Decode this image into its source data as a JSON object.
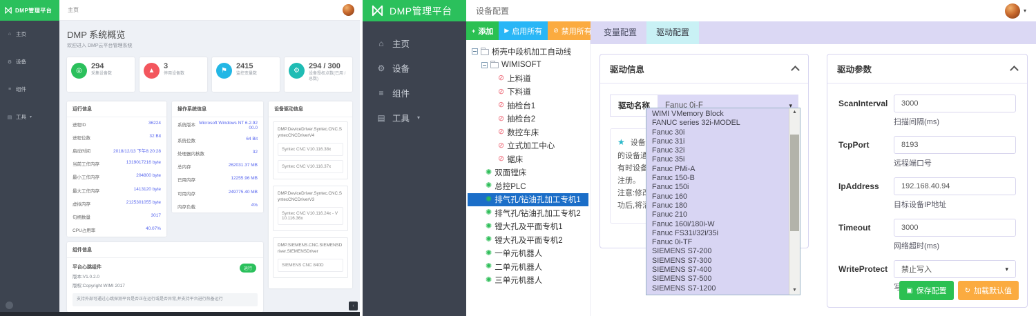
{
  "icons": {
    "home": "⌂",
    "devices": "⚙",
    "components": "≡",
    "tools": "▤",
    "caret_down": "▾",
    "add": "+",
    "enable": "▶",
    "disable": "⊘",
    "scroll_up": "▲",
    "scroll_down": "▼",
    "star": "★",
    "gear_node": "✺",
    "disabled_node": "⊘",
    "save": "▣",
    "reload": "↻",
    "collapse_left": "‹",
    "stat_collect": "◎",
    "stat_stop": "▲",
    "stat_var": "⚑",
    "stat_license": "⚙"
  },
  "sidebar_items": [
    {
      "icon": "home",
      "label": "主页",
      "caret": false
    },
    {
      "icon": "devices",
      "label": "设备",
      "caret": false
    },
    {
      "icon": "components",
      "label": "组件",
      "caret": false
    },
    {
      "icon": "tools",
      "label": "工具",
      "caret": true
    }
  ],
  "left_app": {
    "logo": "DMP管理平台",
    "breadcrumb": "主页",
    "page_title": "DMP 系统概览",
    "page_subtitle": "欢迎进入 DMP云平台管理系统",
    "stats": [
      {
        "value": "294",
        "label": "采集设备数",
        "color": "#2bc05c",
        "icon": "stat_collect"
      },
      {
        "value": "3",
        "label": "停用设备数",
        "color": "#f3565d",
        "icon": "stat_stop"
      },
      {
        "value": "2415",
        "label": "监控变量数",
        "color": "#23b7e5",
        "icon": "stat_var"
      },
      {
        "value": "294 / 300",
        "label": "设备授权点数(已用 / 总数)",
        "color": "#1fbcb4",
        "icon": "stat_license"
      }
    ],
    "run_info": {
      "title": "运行信息",
      "rows": [
        {
          "l": "进程ID",
          "v": "36224"
        },
        {
          "l": "进程位数",
          "v": "32 Bit"
        },
        {
          "l": "启动时间",
          "v": "2018/12/13 下午8:20:28"
        },
        {
          "l": "当前工作内存",
          "v": "1319017216 byte"
        },
        {
          "l": "最小工作内存",
          "v": "204800 byte"
        },
        {
          "l": "最大工作内存",
          "v": "1413120 byte"
        },
        {
          "l": "虚拟内存",
          "v": "2125301055 byte"
        },
        {
          "l": "句柄数量",
          "v": "3017"
        },
        {
          "l": "CPU占用率",
          "v": "40.07%"
        }
      ]
    },
    "os_info": {
      "title": "操作系统信息",
      "rows": [
        {
          "l": "系统版本",
          "v": "Microsoft Windows NT 6.2.9200.0"
        },
        {
          "l": "系统位数",
          "v": "64 Bit"
        },
        {
          "l": "处理器内核数",
          "v": "32"
        },
        {
          "l": "总内存",
          "v": "262031.37 MB"
        },
        {
          "l": "已用内存",
          "v": "12255.96 MB"
        },
        {
          "l": "可用内存",
          "v": "249775.40 MB"
        },
        {
          "l": "内存负载",
          "v": "4%"
        }
      ]
    },
    "component_info": {
      "title": "组件信息",
      "name": "平台心跳组件",
      "version": "版本:V1.0.2.0",
      "copyright": "版权:Copyright WIMI 2017",
      "badge": "运行",
      "description": "支持外部可通过心跳探测平台是否正在运行或是否异常,并支持平台进行热备运行"
    },
    "driver_info": {
      "title": "设备驱动信息",
      "groups": [
        {
          "name": "DMP.DeviceDriver.Syntec.CNC.SyntecCNCDriverV4",
          "items": [
            "Syntec CNC V10.116.38x",
            "Syntec CNC V10.116.37x"
          ]
        },
        {
          "name": "DMP.DeviceDriver.Syntec.CNC.SyntecCNCDriverV3",
          "items": [
            "Syntec CNC V10.116.24x - V10.116.36x"
          ]
        },
        {
          "name": "DMP.SIEMENS.CNC.SIEMENSDriver.SIEMENSDriver",
          "items": [
            "SIEMENS CNC 840D"
          ]
        }
      ]
    }
  },
  "right_app": {
    "logo": "DMP管理平台",
    "breadcrumb": "设备配置",
    "toolbar": {
      "add": "添加",
      "enable_all": "启用所有",
      "disable_all": "禁用所有"
    },
    "tree": {
      "items": [
        {
          "label": "桥壳中段机加工自动线",
          "type": "folder",
          "level": 0
        },
        {
          "label": "WIMISOFT",
          "type": "folder",
          "level": 1
        },
        {
          "label": "上料道",
          "type": "disabled"
        },
        {
          "label": "下料道",
          "type": "disabled"
        },
        {
          "label": "抽检台1",
          "type": "disabled"
        },
        {
          "label": "抽检台2",
          "type": "disabled"
        },
        {
          "label": "数控车床",
          "type": "disabled"
        },
        {
          "label": "立式加工中心",
          "type": "disabled"
        },
        {
          "label": "锯床",
          "type": "disabled"
        },
        {
          "label": "双面镗床",
          "type": "enabled"
        },
        {
          "label": "总控PLC",
          "type": "enabled"
        },
        {
          "label": "排气孔/钻油孔加工专机1",
          "type": "enabled",
          "selected": true
        },
        {
          "label": "排气孔/钻油孔加工专机2",
          "type": "enabled"
        },
        {
          "label": "镗大孔及平面专机1",
          "type": "enabled"
        },
        {
          "label": "镗大孔及平面专机2",
          "type": "enabled"
        },
        {
          "label": "一单元机器人",
          "type": "enabled"
        },
        {
          "label": "二单元机器人",
          "type": "enabled"
        },
        {
          "label": "三单元机器人",
          "type": "enabled"
        }
      ]
    },
    "tabs": [
      {
        "label": "变量配置",
        "active": false
      },
      {
        "label": "驱动配置",
        "active": true
      }
    ],
    "driver_info_card": {
      "title": "驱动信息",
      "field_label": "驱动名称",
      "field_value": "Fanuc 0i-F",
      "note_lines": [
        "设备驱",
        "的设备通讯",
        "有时设备驱",
        "注册。",
        "注意:修改",
        "功后,将清"
      ],
      "options": [
        "WIMI VMemory Block",
        "FANUC series 32i-MODEL",
        "Fanuc 30i",
        "Fanuc 31i",
        "Fanuc 32i",
        "Fanuc 35i",
        "Fanuc PMi-A",
        "Fanuc 150-B",
        "Fanuc 150i",
        "Fanuc 160",
        "Fanuc 180",
        "Fanuc 210",
        "Fanuc 160i/180i-W",
        "Fanuc FS31i/32i/35i",
        "Fanuc 0i-TF",
        "SIEMENS S7-200",
        "SIEMENS S7-300",
        "SIEMENS S7-400",
        "SIEMENS S7-500",
        "SIEMENS S7-1200"
      ]
    },
    "driver_params_card": {
      "title": "驱动参数",
      "fields": [
        {
          "name": "ScanInterval",
          "value": "3000",
          "hint": "扫描间隔(ms)",
          "type": "input"
        },
        {
          "name": "TcpPort",
          "value": "8193",
          "hint": "远程端口号",
          "type": "input"
        },
        {
          "name": "IpAddress",
          "value": "192.168.40.94",
          "hint": "目标设备IP地址",
          "type": "input"
        },
        {
          "name": "Timeout",
          "value": "3000",
          "hint": "网络超时(ms)",
          "type": "input"
        },
        {
          "name": "WriteProtect",
          "value": "禁止写入",
          "hint": "写入保护",
          "type": "select"
        }
      ],
      "save_label": "保存配置",
      "load_default_label": "加载默认值"
    }
  }
}
